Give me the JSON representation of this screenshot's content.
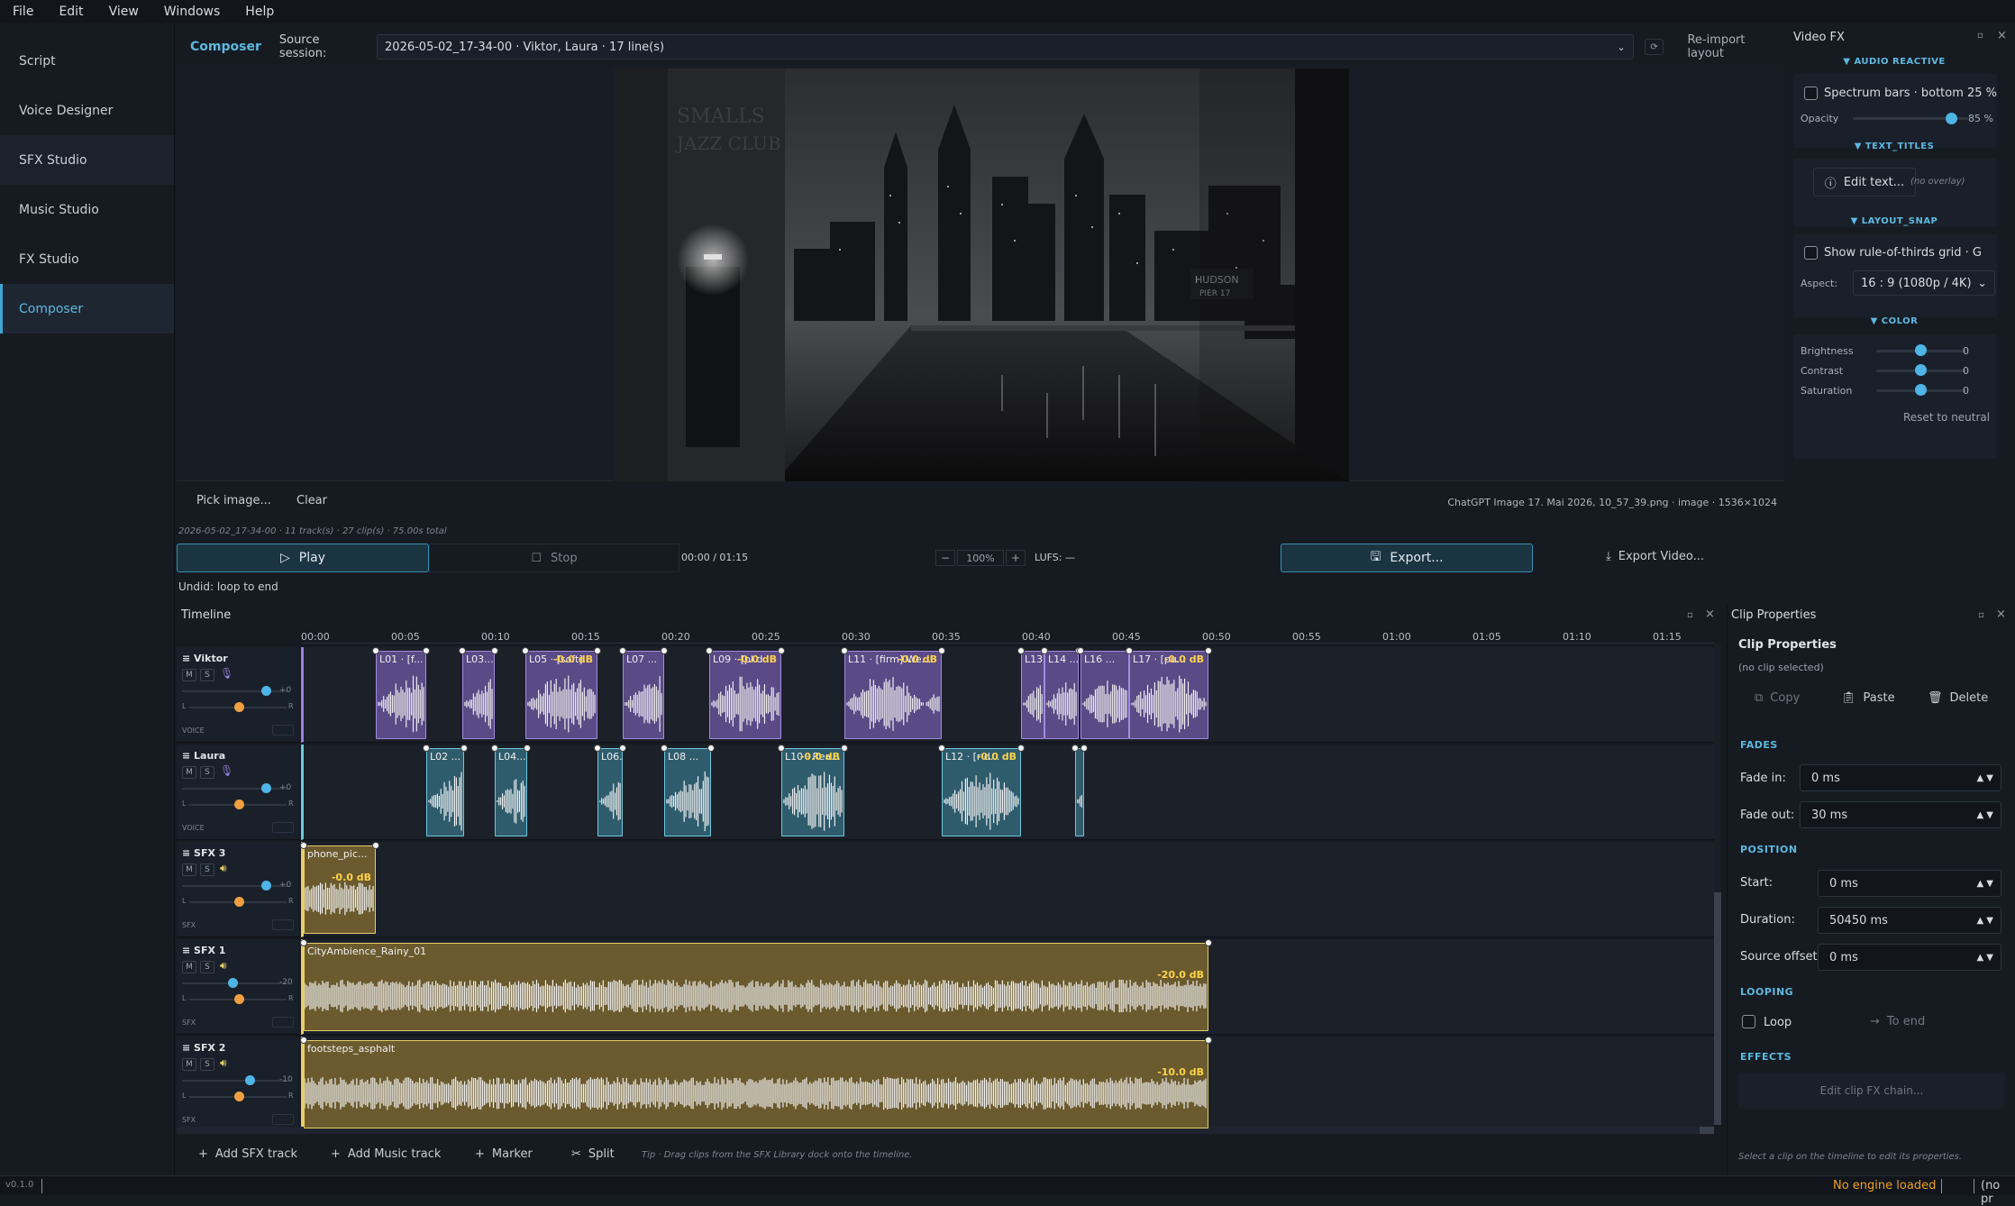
{
  "menu": [
    "File",
    "Edit",
    "View",
    "Windows",
    "Help"
  ],
  "sidebar": {
    "items": [
      {
        "label": "Script"
      },
      {
        "label": "Voice Designer"
      },
      {
        "label": "SFX Studio"
      },
      {
        "label": "Music Studio"
      },
      {
        "label": "FX Studio"
      },
      {
        "label": "Composer"
      }
    ]
  },
  "composer": {
    "tab_label": "Composer",
    "source_label": "Source session:",
    "source_value": "2026-05-02_17-34-00 · Viktor, Laura · 17 line(s)",
    "reimport_label": "Re-import layout",
    "pick_image": "Pick image...",
    "clear": "Clear",
    "image_info": "ChatGPT Image 17. Mai 2026, 10_57_39.png · image · 1536×1024",
    "session_info": "2026-05-02_17-34-00 · 11 track(s) · 27 clip(s) · 75.00s total",
    "play": "Play",
    "stop": "Stop",
    "time": "00:00 / 01:15",
    "zoom_minus": "−",
    "zoom": "100%",
    "zoom_plus": "+",
    "lufs": "LUFS: —",
    "export": "Export...",
    "export_video": "Export Video...",
    "undo_hint": "Undid: loop to end",
    "image_sign1": "SMALLS",
    "image_sign2": "JAZZ CLUB",
    "image_sign3": "HUDSON",
    "image_sign4": "PIER 17"
  },
  "videofx": {
    "title": "Video FX",
    "audio_reactive": "▼ AUDIO REACTIVE",
    "spectrum": "Spectrum bars · bottom 25 %",
    "opacity_label": "Opacity",
    "opacity_value": "85 %",
    "opacity_level": 0.85,
    "text_titles": "▼ TEXT_TITLES",
    "edit_text": "Edit text...",
    "no_overlay": "(no overlay)",
    "layout_snap": "▼ LAYOUT_SNAP",
    "rule_thirds": "Show rule-of-thirds grid · G",
    "aspect_label": "Aspect:",
    "aspect_value": "16 : 9 (1080p / 4K)",
    "color": "▼ COLOR",
    "brightness_label": "Brightness",
    "brightness_value": "0",
    "contrast_label": "Contrast",
    "contrast_value": "0",
    "saturation_label": "Saturation",
    "saturation_value": "0",
    "reset": "Reset to neutral"
  },
  "timeline": {
    "title": "Timeline",
    "ruler": [
      "00:00",
      "00:05",
      "00:10",
      "00:15",
      "00:20",
      "00:25",
      "00:30",
      "00:35",
      "00:40",
      "00:45",
      "00:50",
      "00:55",
      "01:00",
      "01:05",
      "01:10",
      "01:15"
    ],
    "tracks": [
      {
        "name": "Viktor",
        "type": "VOICE",
        "gain": "+0",
        "gain_level": 0.5
      },
      {
        "name": "Laura",
        "type": "VOICE",
        "gain": "+0",
        "gain_level": 0.5
      },
      {
        "name": "SFX 3",
        "type": "SFX",
        "gain": "+0",
        "gain_level": 0.5
      },
      {
        "name": "SFX 1",
        "type": "SFX",
        "gain": "-20",
        "gain_level": 0.0
      },
      {
        "name": "SFX 2",
        "type": "SFX",
        "gain": "-10",
        "gain_level": 0.25
      }
    ],
    "mute": "M",
    "solo": "S",
    "pan_l": "L",
    "pan_r": "R",
    "viktor_clips": [
      {
        "label": "L01 · [f...",
        "start": 4.0,
        "end": 6.8
      },
      {
        "label": "L03...",
        "start": 8.8,
        "end": 10.6
      },
      {
        "label": "L05 · [soft]...",
        "start": 12.3,
        "end": 16.3,
        "db": "-0.0 dB"
      },
      {
        "label": "L07 ...",
        "start": 17.7,
        "end": 20.0
      },
      {
        "label": "L09 · [pl d...",
        "start": 22.5,
        "end": 26.5,
        "db": "-0.0 dB"
      },
      {
        "label": "L11 · [firm] We...",
        "start": 30.0,
        "end": 35.4,
        "db": "-0.0 dB"
      },
      {
        "label": "L13...",
        "start": 39.8,
        "end": 41.1
      },
      {
        "label": "L14 ...",
        "start": 41.1,
        "end": 43.0
      },
      {
        "label": "L16 ...",
        "start": 43.1,
        "end": 45.8
      },
      {
        "label": "L17 · [pu...",
        "start": 45.8,
        "end": 50.2,
        "db": "-0.0 dB"
      }
    ],
    "laura_clips": [
      {
        "label": "L02 ...",
        "start": 6.8,
        "end": 8.9
      },
      {
        "label": "L04...",
        "start": 10.6,
        "end": 12.4
      },
      {
        "label": "L06...",
        "start": 16.3,
        "end": 17.7
      },
      {
        "label": "L08 ...",
        "start": 20.0,
        "end": 22.6
      },
      {
        "label": "L10 · Rea...",
        "start": 26.5,
        "end": 30.0,
        "db": "-0.0 dB"
      },
      {
        "label": "L12 · [r d...",
        "start": 35.4,
        "end": 39.8,
        "db": "-0.0 dB"
      },
      {
        "label": "",
        "start": 42.8,
        "end": 43.3
      }
    ],
    "sfx3_clip": {
      "label": "phone_pic...",
      "start": 0,
      "end": 4.0,
      "db": "-0.0 dB"
    },
    "sfx1_clip": {
      "label": "CityAmbience_Rainy_01",
      "start": 0,
      "end": 50.2,
      "db": "-20.0 dB"
    },
    "sfx2_clip": {
      "label": "footsteps_asphalt",
      "start": 0,
      "end": 50.2,
      "db": "-10.0 dB"
    },
    "add_sfx": "Add SFX track",
    "add_music": "Add Music track",
    "marker": "Marker",
    "split": "Split",
    "tip": "Tip · Drag clips from the SFX Library dock onto the timeline."
  },
  "clipprops": {
    "dock_title": "Clip Properties",
    "title": "Clip Properties",
    "subtitle": "(no clip selected)",
    "copy": "Copy",
    "paste": "Paste",
    "delete": "Delete",
    "fades": "FADES",
    "fade_in_label": "Fade in:",
    "fade_in": "0 ms",
    "fade_out_label": "Fade out:",
    "fade_out": "30 ms",
    "position": "POSITION",
    "start_label": "Start:",
    "start": "0 ms",
    "duration_label": "Duration:",
    "duration": "50450 ms",
    "offset_label": "Source offset:",
    "offset": "0 ms",
    "looping": "LOOPING",
    "loop": "Loop",
    "to_end": "To end",
    "effects": "EFFECTS",
    "edit_fx": "Edit clip FX chain...",
    "hint": "Select a clip on the timeline to edit its properties."
  },
  "status": {
    "version": "v0.1.0",
    "engine": "No engine loaded",
    "right": "(no pr"
  }
}
